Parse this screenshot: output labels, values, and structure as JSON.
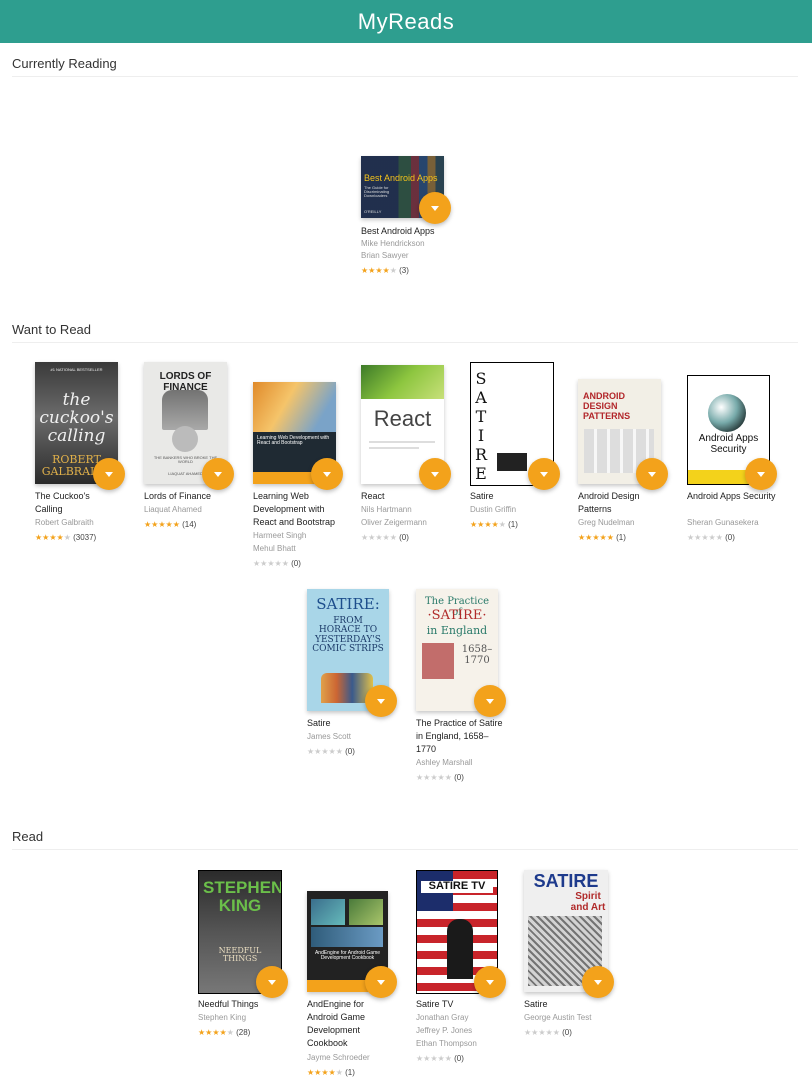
{
  "app": {
    "title": "MyReads"
  },
  "shelves": {
    "currently": {
      "title": "Currently Reading"
    },
    "want": {
      "title": "Want to Read"
    },
    "read": {
      "title": "Read"
    }
  },
  "books": {
    "best_android": {
      "title": "Best Android Apps",
      "authors": [
        "Mike Hendrickson",
        "Brian Sawyer"
      ],
      "stars": 4,
      "count": "(3)",
      "cover": {
        "text1": "Best Android Apps",
        "text2": "The Guide for Discriminating Downloaders",
        "publisher": "O'REILLY"
      }
    },
    "cuckoo": {
      "title": "The Cuckoo's Calling",
      "authors": [
        "Robert Galbraith"
      ],
      "stars": 3.5,
      "count": "(3037)",
      "cover": {
        "text1": "#1 NATIONAL BESTSELLER",
        "text2": "the cuckoo's calling",
        "text3": "ROBERT GALBRAITH"
      }
    },
    "lords": {
      "title": "Lords of Finance",
      "authors": [
        "Liaquat Ahamed"
      ],
      "stars": 4.5,
      "count": "(14)",
      "cover": {
        "text1": "LORDS OF FINANCE",
        "text2": "THE BANKERS WHO BROKE THE WORLD",
        "text3": "LIAQUAT AHAMED"
      }
    },
    "learning_web": {
      "title": "Learning Web Development with React and Bootstrap",
      "authors": [
        "Harmeet Singh",
        "Mehul Bhatt"
      ],
      "stars": 0,
      "count": "(0)",
      "cover": {
        "text1": "Learning Web Development with React and Bootstrap"
      }
    },
    "react": {
      "title": "React",
      "authors": [
        "Nils Hartmann",
        "Oliver Zeigermann"
      ],
      "stars": 0,
      "count": "(0)",
      "cover": {
        "text1": "React"
      }
    },
    "satire_griffin": {
      "title": "Satire",
      "authors": [
        "Dustin Griffin"
      ],
      "stars": 4,
      "count": "(1)",
      "cover": {
        "text1": "SATIRE"
      }
    },
    "android_design": {
      "title": "Android Design Patterns",
      "authors": [
        "Greg Nudelman"
      ],
      "stars": 5,
      "count": "(1)",
      "cover": {
        "text1": "ANDROID DESIGN PATTERNS"
      }
    },
    "android_security": {
      "title": "Android Apps Security",
      "authors": [
        "Sheran Gunasekera"
      ],
      "stars": 0,
      "count": "(0)",
      "cover": {
        "text1": "Android Apps Security"
      }
    },
    "satire_scott": {
      "title": "Satire",
      "authors": [
        "James Scott"
      ],
      "stars": 0,
      "count": "(0)",
      "cover": {
        "text1": "SATIRE:",
        "text2": "FROM HORACE TO YESTERDAY'S COMIC STRIPS"
      }
    },
    "practice_satire": {
      "title": "The Practice of Satire in England, 1658–1770",
      "authors": [
        "Ashley Marshall"
      ],
      "stars": 0,
      "count": "(0)",
      "cover": {
        "text1": "The Practice of",
        "text2": "·SATIRE·",
        "text3": "in England",
        "text4": "1658–1770"
      }
    },
    "needful": {
      "title": "Needful Things",
      "authors": [
        "Stephen King"
      ],
      "stars": 3.5,
      "count": "(28)",
      "cover": {
        "text1": "STEPHEN KING",
        "text2": "NEEDFUL THINGS"
      }
    },
    "andengine": {
      "title": "AndEngine for Android Game Development Cookbook",
      "authors": [
        "Jayme Schroeder"
      ],
      "stars": 4,
      "count": "(1)",
      "cover": {
        "text1": "AndEngine for Android Game Development Cookbook"
      }
    },
    "satire_tv": {
      "title": "Satire TV",
      "authors": [
        "Jonathan Gray",
        "Jeffrey P. Jones",
        "Ethan Thompson"
      ],
      "stars": 0,
      "count": "(0)",
      "cover": {
        "text1": "SATIRE TV"
      }
    },
    "satire_test": {
      "title": "Satire",
      "authors": [
        "George Austin Test"
      ],
      "stars": 0,
      "count": "(0)",
      "cover": {
        "text1": "SATIRE",
        "text2": "Spirit and Art"
      }
    }
  },
  "colors": {
    "header": "#2e9e8f",
    "accent": "#f3a21b"
  }
}
